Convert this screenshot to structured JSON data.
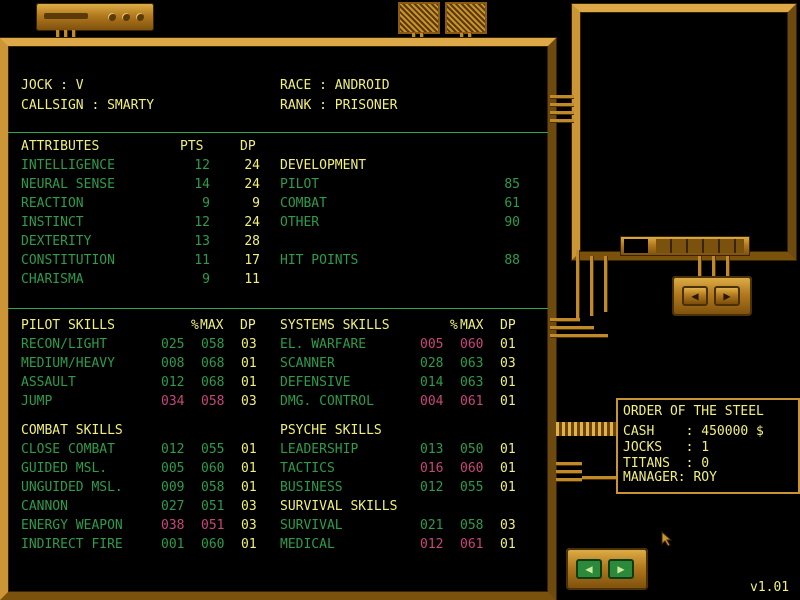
{
  "header": {
    "jock_label": "JOCK : V",
    "callsign_label": "CALLSIGN : SMARTY",
    "race_label": "RACE : ANDROID",
    "rank_label": "RANK : PRISONER"
  },
  "attributes": {
    "title": "ATTRIBUTES",
    "pts_header": "PTS",
    "dp_header": "DP",
    "rows": [
      {
        "name": "INTELLIGENCE",
        "pts": "12",
        "dp": "24"
      },
      {
        "name": "NEURAL SENSE",
        "pts": "14",
        "dp": "24"
      },
      {
        "name": "REACTION",
        "pts": "9",
        "dp": "9"
      },
      {
        "name": "INSTINCT",
        "pts": "12",
        "dp": "24"
      },
      {
        "name": "DEXTERITY",
        "pts": "13",
        "dp": "28"
      },
      {
        "name": "CONSTITUTION",
        "pts": "11",
        "dp": "17"
      },
      {
        "name": "CHARISMA",
        "pts": "9",
        "dp": "11"
      }
    ]
  },
  "development": {
    "title": "DEVELOPMENT",
    "rows": [
      {
        "name": "PILOT",
        "value": "85"
      },
      {
        "name": "COMBAT",
        "value": "61"
      },
      {
        "name": "OTHER",
        "value": "90"
      }
    ],
    "hit_points_label": "HIT POINTS",
    "hit_points_value": "88"
  },
  "pilot_skills": {
    "title": "PILOT SKILLS",
    "pct_header": "%",
    "max_header": "MAX",
    "dp_header": "DP",
    "rows": [
      {
        "name": "RECON/LIGHT",
        "pct": "025",
        "max": "058",
        "dp": "03"
      },
      {
        "name": "MEDIUM/HEAVY",
        "pct": "008",
        "max": "068",
        "dp": "01"
      },
      {
        "name": "ASSAULT",
        "pct": "012",
        "max": "068",
        "dp": "01"
      },
      {
        "name": "JUMP",
        "pct": "034",
        "max": "058",
        "dp": "03"
      }
    ]
  },
  "systems_skills": {
    "title": "SYSTEMS SKILLS",
    "pct_header": "%",
    "max_header": "MAX",
    "dp_header": "DP",
    "rows": [
      {
        "name": "EL. WARFARE",
        "pct": "005",
        "max": "060",
        "dp": "01"
      },
      {
        "name": "SCANNER",
        "pct": "028",
        "max": "063",
        "dp": "03"
      },
      {
        "name": "DEFENSIVE",
        "pct": "014",
        "max": "063",
        "dp": "01"
      },
      {
        "name": "DMG. CONTROL",
        "pct": "004",
        "max": "061",
        "dp": "01"
      }
    ]
  },
  "combat_skills": {
    "title": "COMBAT SKILLS",
    "rows": [
      {
        "name": "CLOSE COMBAT",
        "pct": "012",
        "max": "055",
        "dp": "01"
      },
      {
        "name": "GUIDED MSL.",
        "pct": "005",
        "max": "060",
        "dp": "01"
      },
      {
        "name": "UNGUIDED MSL.",
        "pct": "009",
        "max": "058",
        "dp": "01"
      },
      {
        "name": "CANNON",
        "pct": "027",
        "max": "051",
        "dp": "03"
      },
      {
        "name": "ENERGY WEAPON",
        "pct": "038",
        "max": "051",
        "dp": "03"
      },
      {
        "name": "INDIRECT FIRE",
        "pct": "001",
        "max": "060",
        "dp": "01"
      }
    ]
  },
  "psyche_skills": {
    "title": "PSYCHE SKILLS",
    "rows": [
      {
        "name": "LEADERSHIP",
        "pct": "013",
        "max": "050",
        "dp": "01"
      },
      {
        "name": "TACTICS",
        "pct": "016",
        "max": "060",
        "dp": "01"
      },
      {
        "name": "BUSINESS",
        "pct": "012",
        "max": "055",
        "dp": "01"
      }
    ]
  },
  "survival_skills": {
    "title": "SURVIVAL SKILLS",
    "rows": [
      {
        "name": "SURVIVAL",
        "pct": "021",
        "max": "058",
        "dp": "03"
      },
      {
        "name": "MEDICAL",
        "pct": "012",
        "max": "061",
        "dp": "01"
      }
    ]
  },
  "order_panel": {
    "title": "ORDER OF THE STEEL",
    "cash": "CASH    : 450000 $",
    "jocks": "JOCKS   : 1",
    "titans": "TITANS  : 0",
    "manager": "MANAGER: ROY"
  },
  "version": "v1.01",
  "icons": {
    "left_arrow": "◀",
    "right_arrow": "▶"
  },
  "colors": {
    "label_yellow": "#f2f07a",
    "value_green": "#2e9c4a",
    "highlight_pink": "#c8467a",
    "brass": "#c08a2a"
  }
}
